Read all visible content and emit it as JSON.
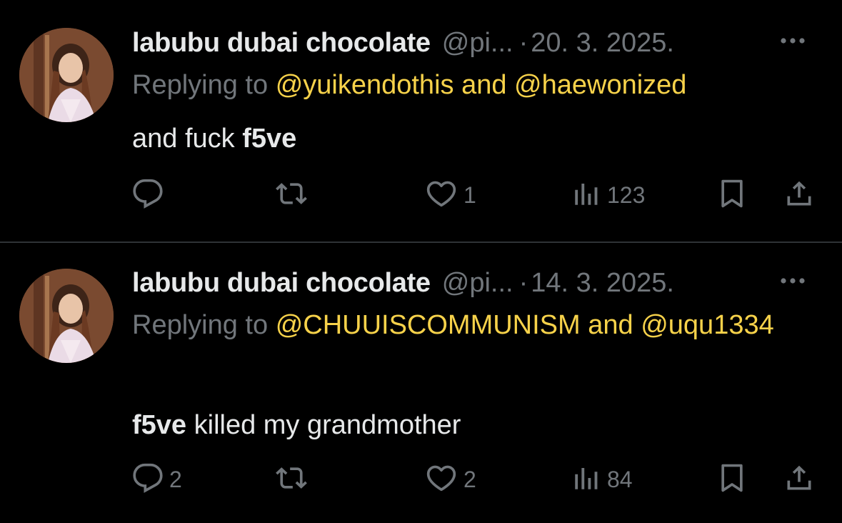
{
  "colors": {
    "background": "#000000",
    "text_primary": "#e7e9ea",
    "text_secondary": "#71767b",
    "mention": "#f7d24a",
    "divider": "#2f3336"
  },
  "tweets": [
    {
      "display_name": "labubu dubai chocolate",
      "handle": "@pi...",
      "separator": "·",
      "date": "20. 3. 2025.",
      "replying_prefix": "Replying to",
      "mention_1": "@yuikendothis",
      "joiner": "and",
      "mention_2": "@haewonized",
      "text_before": "and fuck ",
      "text_bold": "f5ve",
      "text_after": "",
      "reply_count": "",
      "retweet_count": "",
      "like_count": "1",
      "view_count": "123",
      "icons": [
        "reply-icon",
        "retweet-icon",
        "heart-icon",
        "views-icon",
        "bookmark-icon",
        "share-icon",
        "more-icon"
      ]
    },
    {
      "display_name": "labubu dubai chocolate",
      "handle": "@pi...",
      "separator": "·",
      "date": "14. 3. 2025.",
      "replying_prefix": "Replying to",
      "mention_1": "@CHUUISCOMMUNISM",
      "joiner": "and",
      "mention_2": "@uqu1334",
      "text_before": "",
      "text_bold": "f5ve",
      "text_after": " killed my grandmother",
      "reply_count": "2",
      "retweet_count": "",
      "like_count": "2",
      "view_count": "84",
      "icons": [
        "reply-icon",
        "retweet-icon",
        "heart-icon",
        "views-icon",
        "bookmark-icon",
        "share-icon",
        "more-icon"
      ]
    }
  ]
}
